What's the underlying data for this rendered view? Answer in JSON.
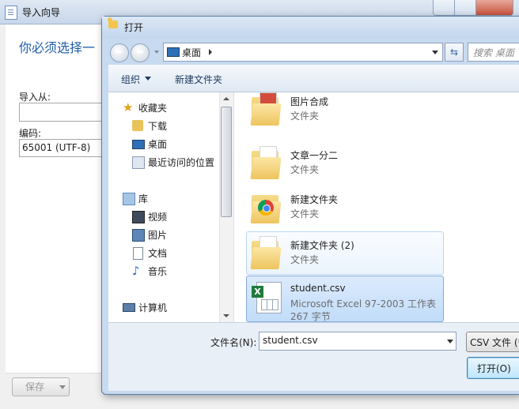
{
  "wizard": {
    "title": "导入向导",
    "heading": "你必须选择一",
    "import_from_label": "导入从:",
    "import_from_value": "",
    "encoding_label": "编码:",
    "encoding_value": "65001 (UTF-8)",
    "save_button": "保存"
  },
  "dialog": {
    "title": "打开",
    "address": {
      "location": "桌面",
      "icon": "desktop-icon"
    },
    "search_placeholder": "搜索 桌面",
    "toolbar": {
      "organize": "组织",
      "new_folder": "新建文件夹"
    },
    "nav": {
      "favorites": [
        {
          "label": "收藏夹",
          "icon": "star-icon"
        },
        {
          "label": "下载",
          "icon": "download-folder-icon"
        },
        {
          "label": "桌面",
          "icon": "desktop-icon"
        },
        {
          "label": "最近访问的位置",
          "icon": "recent-places-icon"
        }
      ],
      "libraries": [
        {
          "label": "库",
          "icon": "library-icon"
        },
        {
          "label": "视频",
          "icon": "video-icon"
        },
        {
          "label": "图片",
          "icon": "picture-icon"
        },
        {
          "label": "文档",
          "icon": "document-icon"
        },
        {
          "label": "音乐",
          "icon": "music-icon"
        }
      ],
      "computer": {
        "label": "计算机",
        "icon": "computer-icon"
      }
    },
    "files": [
      {
        "name": "图片合成",
        "type": "文件夹",
        "icon": "folder-icon",
        "state": "normal"
      },
      {
        "name": "文章一分二",
        "type": "文件夹",
        "icon": "folder-icon",
        "state": "normal"
      },
      {
        "name": "新建文件夹",
        "type": "文件夹",
        "icon": "chrome-folder-icon",
        "state": "normal"
      },
      {
        "name": "新建文件夹 (2)",
        "type": "文件夹",
        "icon": "folder-icon",
        "state": "hover"
      },
      {
        "name": "student.csv",
        "type": "Microsoft Excel 97-2003 工作表",
        "size": "267 字节",
        "icon": "excel-csv-icon",
        "state": "selected"
      }
    ],
    "filename_label": "文件名(N):",
    "filename_value": "student.csv",
    "filetype_value": "CSV 文件 (*",
    "open_button": "打开(O)"
  },
  "colors": {
    "accent": "#1f5eaa",
    "selection": "#c1dcfa",
    "title_bar": "#c8daef"
  }
}
